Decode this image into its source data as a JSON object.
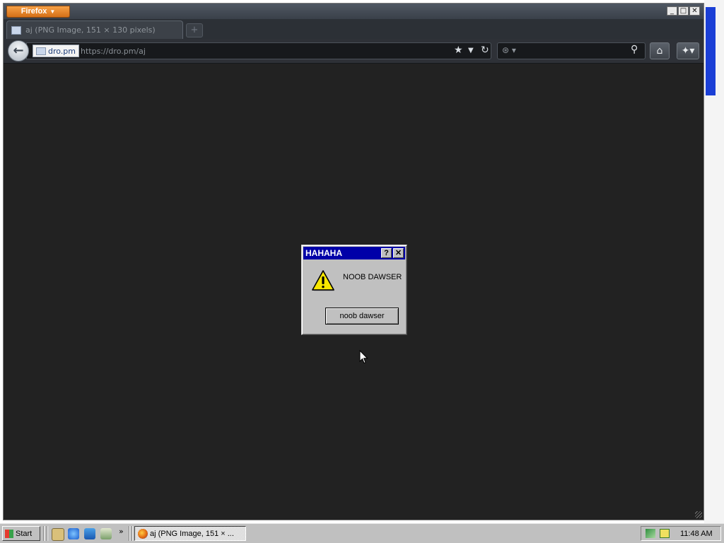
{
  "browser": {
    "menu_button_label": "Firefox",
    "menu_caret": "▼",
    "window_controls": {
      "minimize": "_",
      "maximize": "□",
      "close": "✕"
    },
    "tab": {
      "title": "aj (PNG Image, 151 × 130 pixels)"
    },
    "new_tab_icon": "plus-icon",
    "address": {
      "domain": "dro.pm",
      "url": "https://dro.pm/aj"
    },
    "icons": [
      "back-arrow-icon",
      "bookmark-star-icon",
      "dropdown-arrow-icon",
      "reload-icon",
      "search-engine-icon",
      "search-icon",
      "home-icon",
      "bookmarks-menu-icon"
    ]
  },
  "dialog": {
    "title": "HAHAHA",
    "help_label": "?",
    "close_label": "✕",
    "message": "NOOB DAWSER",
    "button_label": "noob dawser",
    "icon": "warning-icon"
  },
  "taskbar": {
    "start_label": "Start",
    "quick_launch_icons": [
      "show-desktop-icon",
      "internet-explorer-icon",
      "outlook-express-icon",
      "media-icon"
    ],
    "quick_launch_more": "»",
    "task_firefox_label": "aj (PNG Image, 151 × ...",
    "tray_icons": [
      "network-icon",
      "security-icon"
    ],
    "clock": "11:48 AM"
  },
  "colors": {
    "page_background": "#222222",
    "dialog_titlebar": "#0000a8",
    "firefox_orange": "#e8801e",
    "taskbar": "#c0c0c0"
  }
}
